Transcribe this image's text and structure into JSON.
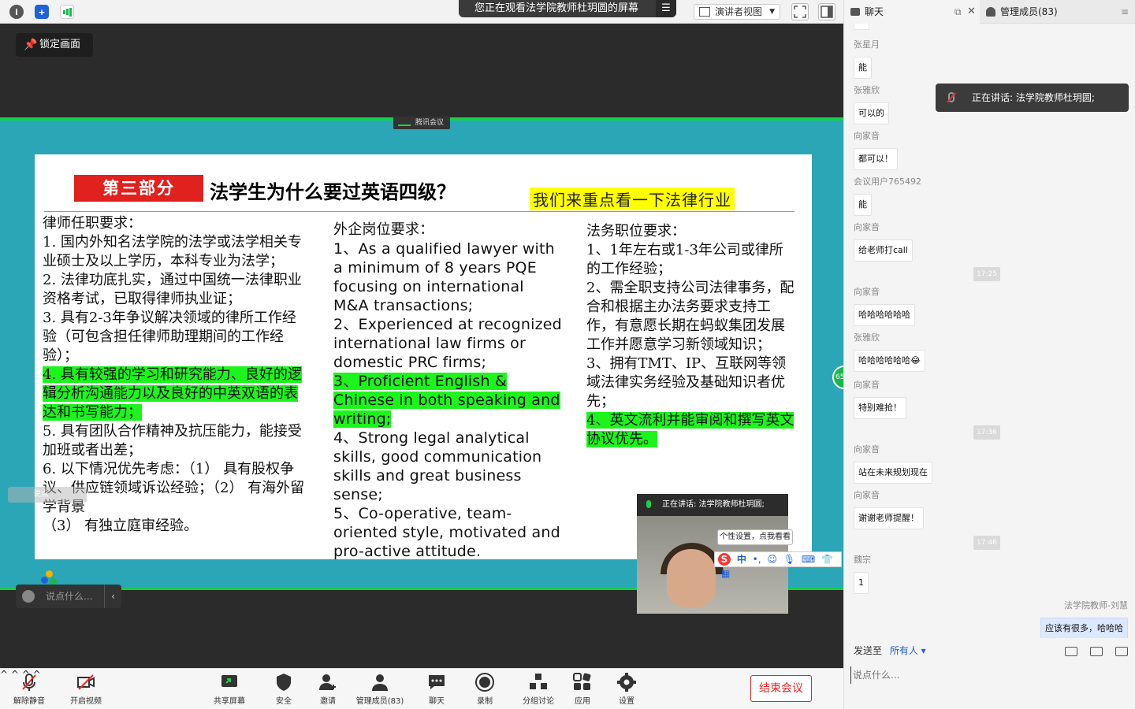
{
  "topbar": {
    "share_banner": "您正在观看法学院教师杜玥圆的屏幕",
    "view_select": "演讲者视图",
    "icons": [
      "info-icon",
      "shield-icon",
      "signal-icon"
    ]
  },
  "stage": {
    "lock_label": "锁定画面",
    "tencent_tag": "腾讯会议",
    "slide": {
      "section": "第三部分",
      "title": "法学生为什么要过英语四级？",
      "highlight": "我们来重点看一下法律行业",
      "col1": {
        "heading": "律师任职要求：",
        "items": [
          "1. 国内外知名法学院的法学或法学相关专业硕士及以上学历，本科专业为法学；",
          "2. 法律功底扎实，通过中国统一法律职业资格考试，已取得律师执业证；",
          "3. 具有2-3年争议解决领域的律所工作经验（可包含担任律师助理期间的工作经验）；"
        ],
        "highlighted": "4. 具有较强的学习和研究能力、良好的逻辑分析沟通能力以及良好的中英双语的表达和书写能力；",
        "rest": [
          "5. 具有团队合作精神及抗压能力，能接受加班或者出差；",
          "6. 以下情况优先考虑：（1） 具有股权争议、供应链领域诉讼经验；（2） 有海外留学背景",
          "（3） 有独立庭审经验。"
        ]
      },
      "col2": {
        "heading": "外企岗位要求：",
        "item1": "1、As a  qualified lawyer with a minimum of 8 years PQE focusing on international  M&A transactions;",
        "item2": "2、Experienced  at recognized international law firms or domestic PRC firms;",
        "item3": "3、Proficient  English & Chinese in both speaking and writing;",
        "item4": "4、Strong  legal analytical skills, good communication skills and great business sense;",
        "item5": "5、Co-operative,  team-oriented style, motivated and pro-active attitude."
      },
      "col3": {
        "heading": "法务职位要求：",
        "item1": "1、1年左右或1-3年公司或律所的工作经验；",
        "item2": "2、需全职支持公司法律事务，配合和根据主办法务要求支持工作，有意愿长期在蚂蚁集团发展工作并愿意学习新领域知识；",
        "item3": "3、拥有TMT、IP、互联网等领域法律实务经验及基础知识者优先；",
        "item4": "4、英文流利并能审阅和撰写英文协议优先。"
      }
    },
    "speaker_video": {
      "header": "正在讲话: 法学院教师杜玥圆;"
    },
    "ime_tip": "个性设置，点我看看",
    "ime_zh": "中",
    "chat_mini_placeholder": "说点什么...",
    "say_ghost": "说点",
    "side_badge": "65"
  },
  "toolbar": {
    "unmute": "解除静音",
    "video": "开启视频",
    "share": "共享屏幕",
    "security": "安全",
    "invite": "邀请",
    "members": "管理成员(83)",
    "chat": "聊天",
    "record": "录制",
    "breakout": "分组讨论",
    "apps": "应用",
    "settings": "设置",
    "end": "结束会议"
  },
  "panel": {
    "tab_chat": "聊天",
    "tab_members": "管理成员(83)",
    "speaking_tip": "正在讲话: 法学院教师杜玥圆;",
    "messages": [
      {
        "who": "张星月",
        "text": "能"
      },
      {
        "who": "张雅欣",
        "text": "可以的"
      },
      {
        "who": "向家音",
        "text": "都可以！"
      },
      {
        "who": "会议用户765492",
        "text": "能"
      },
      {
        "who": "向家音",
        "text": "给老师打call"
      },
      {
        "time": "17:25"
      },
      {
        "who": "向家音",
        "text": "哈哈哈哈哈哈"
      },
      {
        "who": "张雅欣",
        "text": "哈哈哈哈哈哈😂"
      },
      {
        "who": "向家音",
        "text": "特别难抢！"
      },
      {
        "time": "17:36"
      },
      {
        "who": "向家音",
        "text": "站在未来规划现在"
      },
      {
        "who": "向家音",
        "text": "谢谢老师提醒！"
      },
      {
        "time": "17:46"
      },
      {
        "who": "魏宗",
        "text": "1"
      },
      {
        "who": "法学院教师-刘慧",
        "text": "应该有很多，哈哈哈",
        "mine": true
      }
    ],
    "send_to_label": "发送至",
    "send_to_value": "所有人",
    "input_placeholder": "说点什么..."
  }
}
